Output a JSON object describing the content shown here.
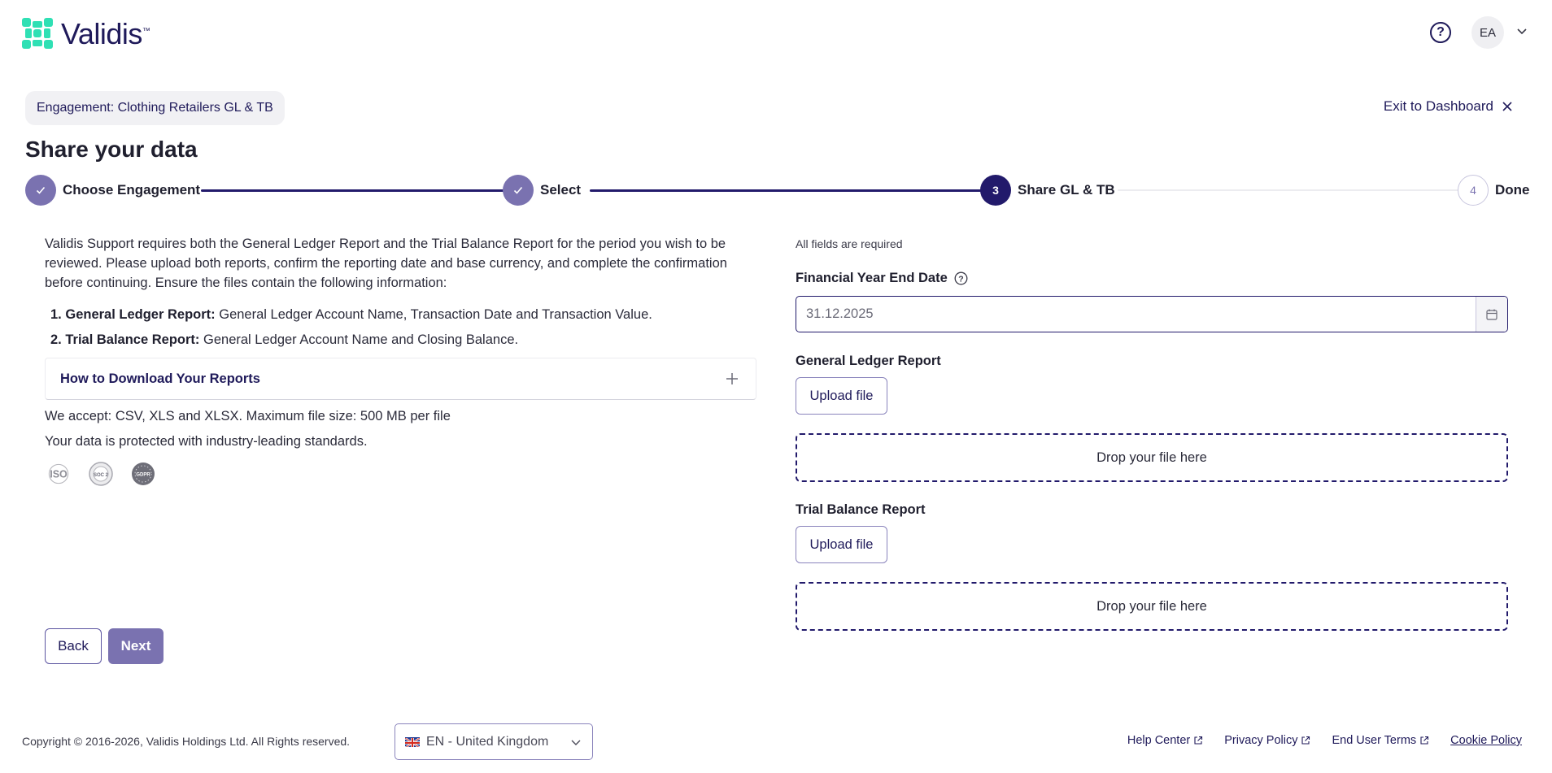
{
  "header": {
    "brand": "Validis",
    "trademark": "™",
    "avatar_initials": "EA"
  },
  "engagement": {
    "label": "Engagement: Clothing Retailers GL & TB",
    "exit_label": "Exit to Dashboard"
  },
  "page": {
    "title": "Share your data"
  },
  "stepper": {
    "steps": [
      {
        "number": "1",
        "label": "Choose Engagement",
        "state": "done"
      },
      {
        "number": "2",
        "label": "Select",
        "state": "done"
      },
      {
        "number": "3",
        "label": "Share GL & TB",
        "state": "current"
      },
      {
        "number": "4",
        "label": "Done",
        "state": "todo"
      }
    ]
  },
  "left": {
    "intro": "Validis Support requires both the General Ledger Report and the Trial Balance Report for the period you wish to be reviewed. Please upload both reports, confirm the reporting date and base currency, and complete the confirmation before continuing. Ensure the files contain the following information:",
    "requirements": [
      {
        "index": "1.",
        "title": "General Ledger Report:",
        "text": " General Ledger Account Name, Transaction Date and Transaction Value."
      },
      {
        "index": "2.",
        "title": "Trial Balance Report:",
        "text": " General Ledger Account Name and Closing Balance."
      }
    ],
    "accordion_title": "How to Download Your Reports",
    "accept_text": "We accept: CSV, XLS and XLSX. Maximum file size: 500 MB per file",
    "protected_text": "Your data is protected with industry-leading standards.",
    "badges": {
      "iso": "ISO",
      "soc": "SOC 2",
      "gdpr": "GDPR"
    },
    "back_label": "Back",
    "next_label": "Next"
  },
  "right": {
    "required_note": "All fields are required",
    "date_label": "Financial Year End Date",
    "date_value": "31.12.2025",
    "gl_label": "General Ledger Report",
    "tb_label": "Trial Balance Report",
    "upload_label": "Upload file",
    "drop_label": "Drop your file here"
  },
  "footer": {
    "copyright": "Copyright © 2016-2026, Validis Holdings Ltd. All Rights reserved.",
    "language": "EN - United Kingdom",
    "links": {
      "help": "Help Center",
      "privacy": "Privacy Policy",
      "terms": "End User Terms",
      "cookie": "Cookie Policy"
    }
  },
  "colors": {
    "primary": "#221a6b",
    "primary_muted": "#7a72b0",
    "brand_green": "#2fe0b4"
  }
}
